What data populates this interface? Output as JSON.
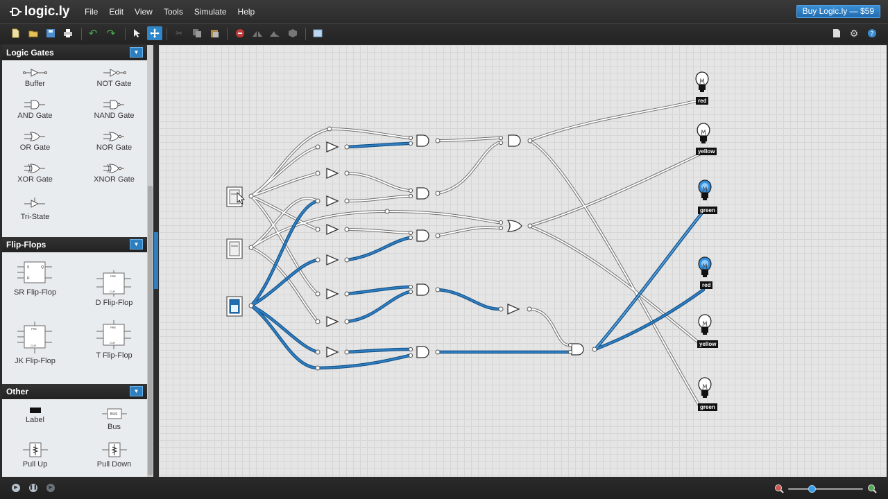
{
  "app": {
    "name": "logic.ly"
  },
  "menu": [
    "File",
    "Edit",
    "View",
    "Tools",
    "Simulate",
    "Help"
  ],
  "buy_button": "Buy Logic.ly — $59",
  "toolbar": {
    "buttons": [
      "new-icon",
      "open-icon",
      "save-icon",
      "print-icon",
      "undo-icon",
      "redo-icon",
      "select-icon",
      "pan-icon",
      "cut-icon",
      "copy-icon",
      "paste-icon",
      "delete-icon",
      "flip-icon",
      "rotate-icon",
      "group-icon",
      "properties-icon"
    ],
    "active": "pan-icon",
    "right_buttons": [
      "document-icon",
      "gear-icon",
      "help-icon"
    ]
  },
  "sidebar": {
    "sections": [
      {
        "title": "Logic Gates",
        "items": [
          "Buffer",
          "NOT Gate",
          "AND Gate",
          "NAND Gate",
          "OR Gate",
          "NOR Gate",
          "XOR Gate",
          "XNOR Gate",
          "Tri-State"
        ]
      },
      {
        "title": "Flip-Flops",
        "items": [
          "SR Flip-Flop",
          "D Flip-Flop",
          "JK Flip-Flop",
          "T Flip-Flop"
        ]
      },
      {
        "title": "Other",
        "items": [
          "Label",
          "Bus",
          "Pull Up",
          "Pull Down"
        ]
      }
    ]
  },
  "canvas": {
    "lamps": [
      {
        "label": "red",
        "on": false
      },
      {
        "label": "yellow",
        "on": false
      },
      {
        "label": "green",
        "on": true
      },
      {
        "label": "red",
        "on": true
      },
      {
        "label": "yellow",
        "on": false
      },
      {
        "label": "green",
        "on": false
      }
    ],
    "switches": [
      {
        "state": "off"
      },
      {
        "state": "off"
      },
      {
        "state": "on"
      }
    ],
    "colors": {
      "active_wire": "#1f6fb0",
      "inactive_wire": "#ffffff",
      "lamp_on": "#2f8fe0"
    }
  },
  "statusbar": {
    "sim_buttons": [
      "play-icon",
      "pause-icon",
      "step-icon"
    ],
    "zoom_level": 0.3
  }
}
